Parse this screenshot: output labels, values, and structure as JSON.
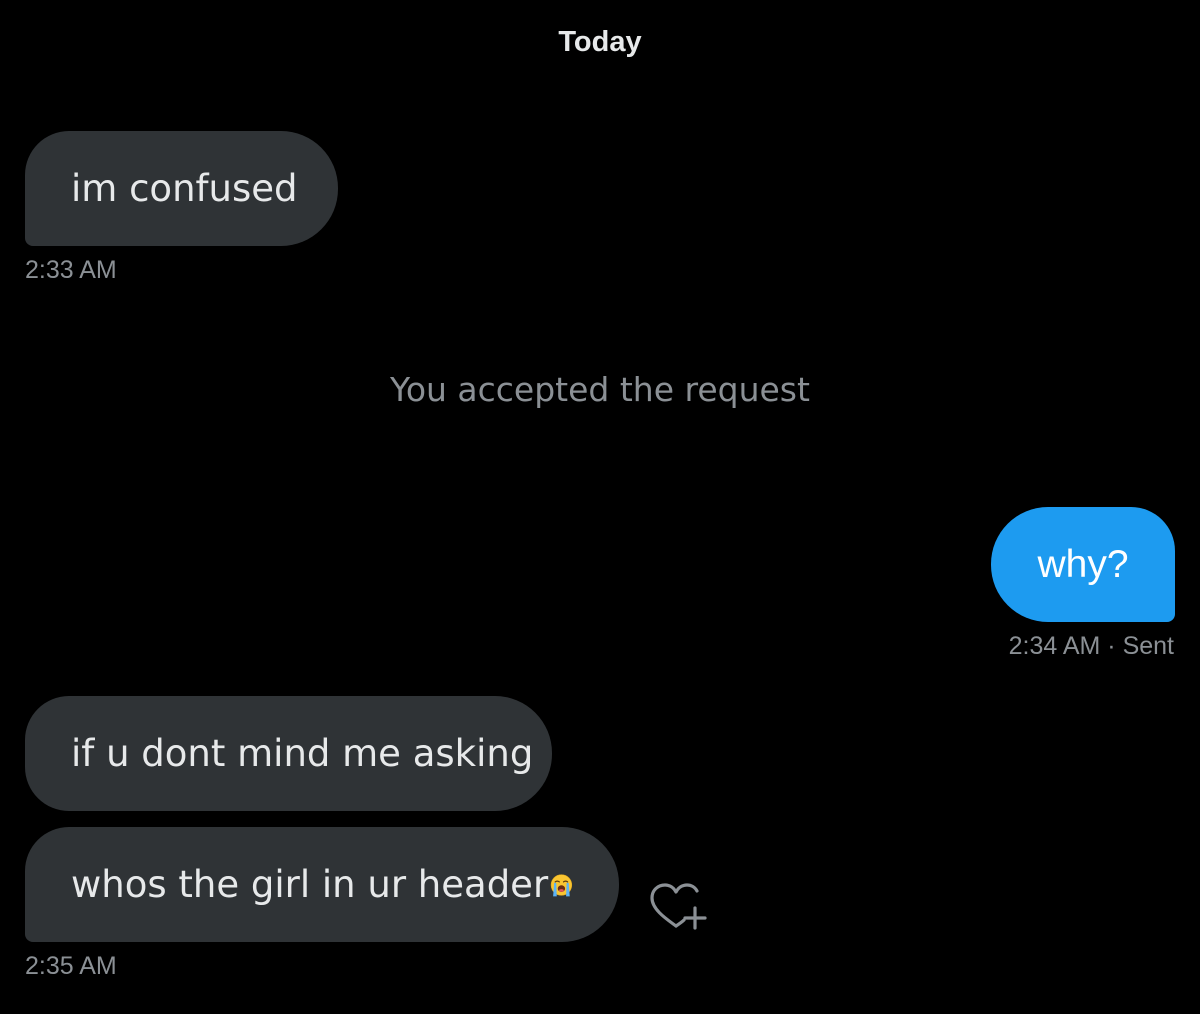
{
  "conversation": {
    "date_divider": "Today",
    "system_message": "You accepted the request",
    "messages": [
      {
        "direction": "received",
        "text": "im confused",
        "time": "2:33 AM"
      },
      {
        "direction": "sent",
        "text": "why?",
        "time": "2:34 AM",
        "status": "· Sent"
      },
      {
        "direction": "received",
        "text": "if u dont mind me asking"
      },
      {
        "direction": "received",
        "text": "whos the girl in ur header",
        "emoji": "loudly-crying-face",
        "time": "2:35 AM"
      }
    ]
  },
  "icons": {
    "emoji": "loudly-crying-face-icon",
    "react": "add-reaction-heart-icon"
  },
  "colors": {
    "background": "#000000",
    "received_bubble": "#2f3336",
    "sent_bubble": "#1d9bf0",
    "text_primary": "#e7e9ea",
    "text_secondary": "#8b9095"
  }
}
